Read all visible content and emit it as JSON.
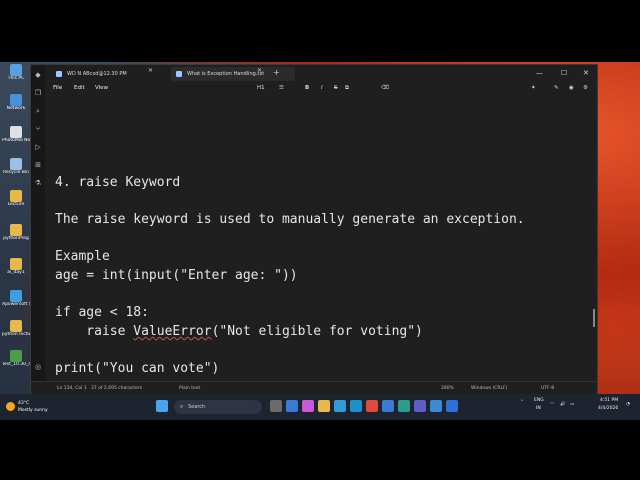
{
  "desktop": {
    "icons": [
      {
        "label": "This PC",
        "color": "#5aa0e0"
      },
      {
        "label": "Network",
        "color": "#4a90d9"
      },
      {
        "label": "PhotoMio Notes",
        "color": "#e0e0e0"
      },
      {
        "label": "Recycle Bin",
        "color": "#9ac0e8"
      },
      {
        "label": "Lecture",
        "color": "#e8b84a"
      },
      {
        "label": "pythonProg",
        "color": "#e8b84a"
      },
      {
        "label": "ai_day1",
        "color": "#e8b84a"
      },
      {
        "label": "Apowersoft Screen Rec...",
        "color": "#3aa0e0"
      },
      {
        "label": "python lecture",
        "color": "#e8b84a"
      },
      {
        "label": "Test_10.30_4",
        "color": "#4a9d4a"
      }
    ]
  },
  "window": {
    "tabs": [
      {
        "label": "WD N ABcxd@12.30 PM"
      },
      {
        "label": "What is Exception Handling.txt"
      }
    ],
    "controls": {
      "minimize": "—",
      "maximize": "☐",
      "close": "✕"
    },
    "menu": {
      "file": "File",
      "edit": "Edit",
      "view": "View"
    },
    "toolbar": {
      "heading": "H1",
      "list": "☰",
      "bold": "B",
      "italic": "I",
      "strike": "S",
      "link": "⧉",
      "clear": "⌫"
    }
  },
  "editor": {
    "lines": [
      "4. raise Keyword",
      "",
      "The raise keyword is used to manually generate an exception.",
      "",
      "Example",
      "age = int(input(\"Enter age: \"))",
      "",
      "if age < 18:",
      "    raise ValueError(\"Not eligible for voting\")",
      "",
      "print(\"You can vote\")"
    ],
    "error_word": "ValueError"
  },
  "status": {
    "position": "Ln 134, Col 1",
    "chars": "37 of 2,695 characters",
    "format": "Plain text",
    "zoom": "280%",
    "eol": "Windows (CRLF)",
    "encoding": "UTF-8"
  },
  "taskbar": {
    "weather_temp": "43°C",
    "weather_desc": "Mostly sunny",
    "search_placeholder": "Search",
    "lang": "ENG",
    "region": "IN",
    "time": "4:51 PM",
    "date": "4/4/2026"
  }
}
